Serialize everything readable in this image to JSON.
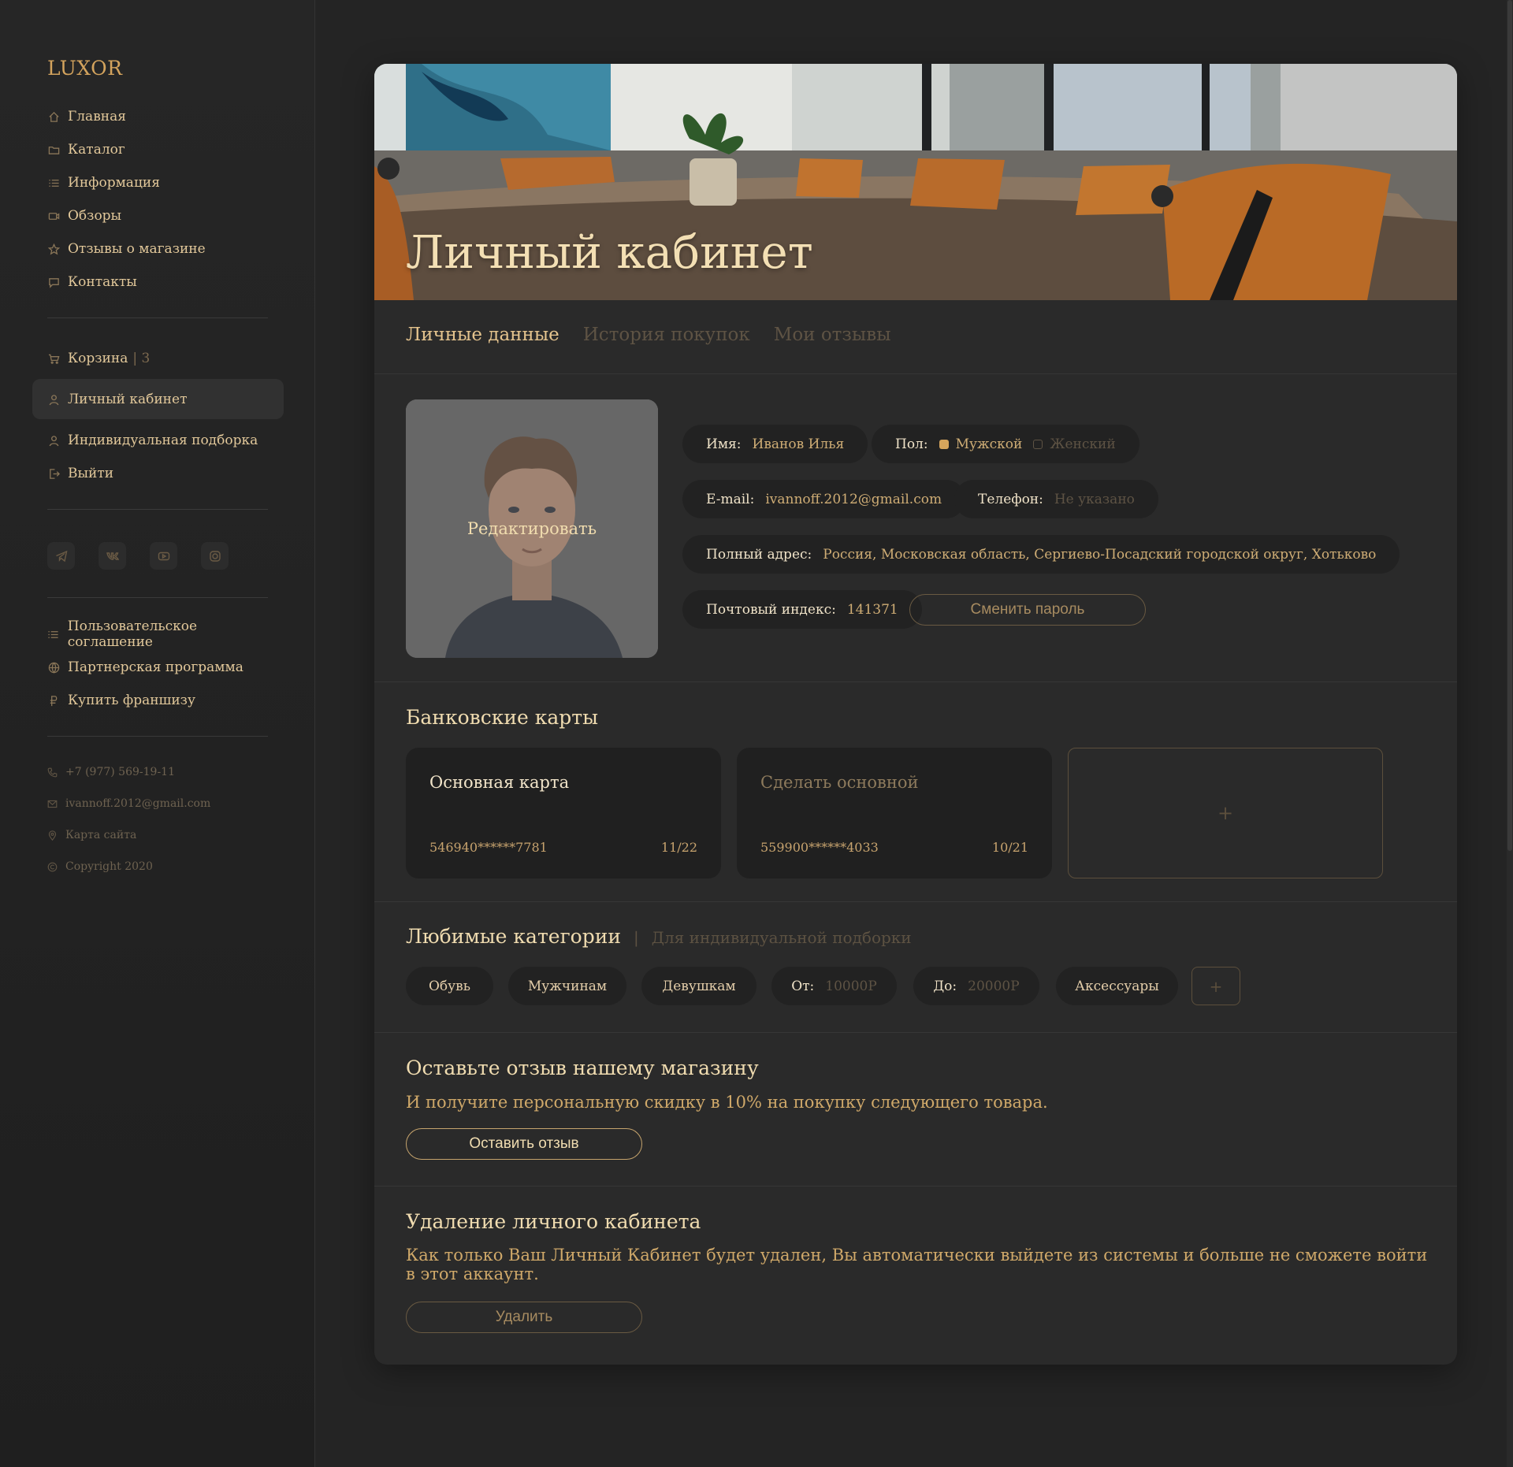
{
  "brand": {
    "logo": "LUXOR"
  },
  "sidebar": {
    "nav": [
      {
        "label": "Главная",
        "icon": "home-icon"
      },
      {
        "label": "Каталог",
        "icon": "folder-icon"
      },
      {
        "label": "Информация",
        "icon": "list-icon"
      },
      {
        "label": "Обзоры",
        "icon": "video-icon"
      },
      {
        "label": "Отзывы о магазине",
        "icon": "star-icon"
      },
      {
        "label": "Контакты",
        "icon": "chat-icon"
      }
    ],
    "account": [
      {
        "label": "Корзина",
        "count": "| 3",
        "icon": "cart-icon"
      },
      {
        "label": "Личный кабинет",
        "icon": "user-icon"
      },
      {
        "label": "Индивидуальная подборка",
        "icon": "user-icon"
      },
      {
        "label": "Выйти",
        "icon": "logout-icon"
      }
    ],
    "socials": [
      "telegram-icon",
      "vk-icon",
      "youtube-icon",
      "instagram-icon"
    ],
    "legal": [
      {
        "label": "Пользовательское соглашение",
        "icon": "list-icon"
      },
      {
        "label": "Партнерская программа",
        "icon": "globe-icon"
      },
      {
        "label": "Купить франшизу",
        "icon": "ruble-icon"
      }
    ],
    "contacts": [
      {
        "label": "+7 (977) 569-19-11",
        "icon": "phone-icon"
      },
      {
        "label": "ivannoff.2012@gmail.com",
        "icon": "mail-icon"
      },
      {
        "label": "Карта сайта",
        "icon": "pin-icon"
      },
      {
        "label": "Copyright 2020",
        "icon": "copyright-icon"
      }
    ]
  },
  "hero": {
    "title": "Личный кабинет"
  },
  "tabs": [
    {
      "label": "Личные данные",
      "active": true
    },
    {
      "label": "История покупок",
      "active": false
    },
    {
      "label": "Мои отзывы",
      "active": false
    }
  ],
  "profile": {
    "edit_label": "Редактировать",
    "name_label": "Имя:",
    "name_value": "Иванов Илья",
    "gender_label": "Пол:",
    "gender_male": "Мужской",
    "gender_female": "Женский",
    "email_label": "E-mail:",
    "email_value": "ivannoff.2012@gmail.com",
    "phone_label": "Телефон:",
    "phone_value": "Не указано",
    "address_label": "Полный адрес:",
    "address_value": "Россия, Московская область, Сергиево-Посадский городской округ, Хотьково",
    "zip_label": "Почтовый индекс:",
    "zip_value": "141371",
    "change_password": "Сменить пароль"
  },
  "cards": {
    "title": "Банковские карты",
    "items": [
      {
        "name": "Основная карта",
        "number": "546940******7781",
        "expiry": "11/22"
      },
      {
        "name": "Сделать основной",
        "number": "559900******4033",
        "expiry": "10/21"
      }
    ],
    "add": "+"
  },
  "categories": {
    "title": "Любимые категории",
    "separator": "|",
    "subtitle": "Для индивидуальной подборки",
    "chips": [
      "Обувь",
      "Мужчинам",
      "Девушкам"
    ],
    "from_label": "От:",
    "from_value": "10000Р",
    "to_label": "До:",
    "to_value": "20000Р",
    "accessories": "Аксессуары",
    "add": "+"
  },
  "review": {
    "title": "Оставьте отзыв нашему магазину",
    "text": "И получите персональную скидку в 10% на покупку следующего товара.",
    "button": "Оставить отзыв"
  },
  "delete": {
    "title": "Удаление личного кабинета",
    "text": "Как только Ваш Личный Кабинет будет удален, Вы автоматически выйдете из системы и больше не сможете войти в этот аккаунт.",
    "button": "Удалить"
  },
  "colors": {
    "accent": "#d3a35d",
    "background": "#242424",
    "card": "#2a2a2a"
  }
}
